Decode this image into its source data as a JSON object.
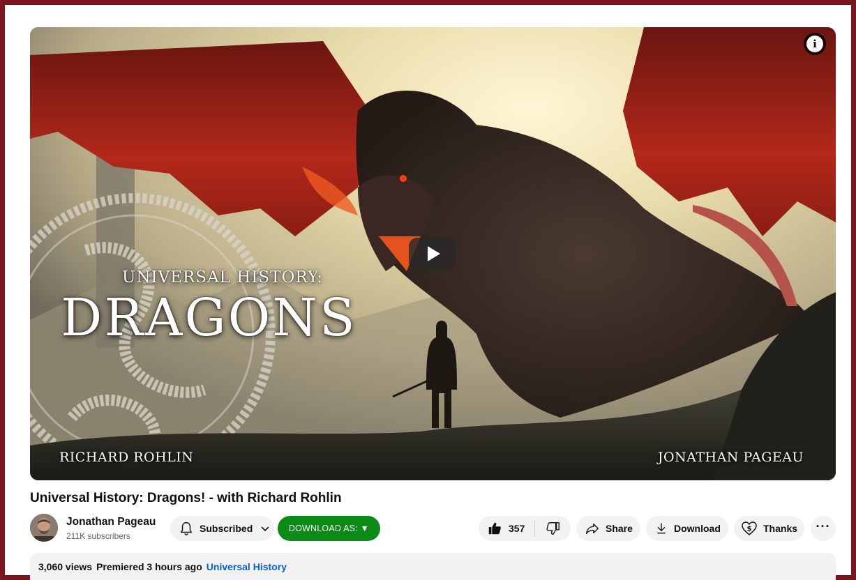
{
  "player": {
    "thumbnail": {
      "subtitle": "UNIVERSAL HISTORY:",
      "title": "DRAGONS",
      "left_name": "RICHARD ROHLIN",
      "right_name": "JONATHAN PAGEAU"
    },
    "info_icon": "i"
  },
  "video": {
    "title": "Universal History: Dragons! - with Richard Rohlin"
  },
  "channel": {
    "name": "Jonathan Pageau",
    "subscribers": "211K subscribers"
  },
  "actions": {
    "subscribed_label": "Subscribed",
    "download_as_label": "DOWNLOAD AS: ▼",
    "like_count": "357",
    "share_label": "Share",
    "download_label": "Download",
    "thanks_label": "Thanks",
    "more_label": "···"
  },
  "description": {
    "views": "3,060 views",
    "premiered": "Premiered 3 hours ago",
    "hashtag": "Universal History"
  },
  "icons": [
    "info-icon",
    "play-icon",
    "bell-icon",
    "chevron-down-icon",
    "thumbs-up-icon",
    "thumbs-down-icon",
    "share-icon",
    "download-icon",
    "thanks-icon",
    "more-icon"
  ],
  "colors": {
    "frame": "#7d1520",
    "download_as_bg": "#0b8a16",
    "link": "#065fd4",
    "pill_bg": "#f2f2f2"
  }
}
